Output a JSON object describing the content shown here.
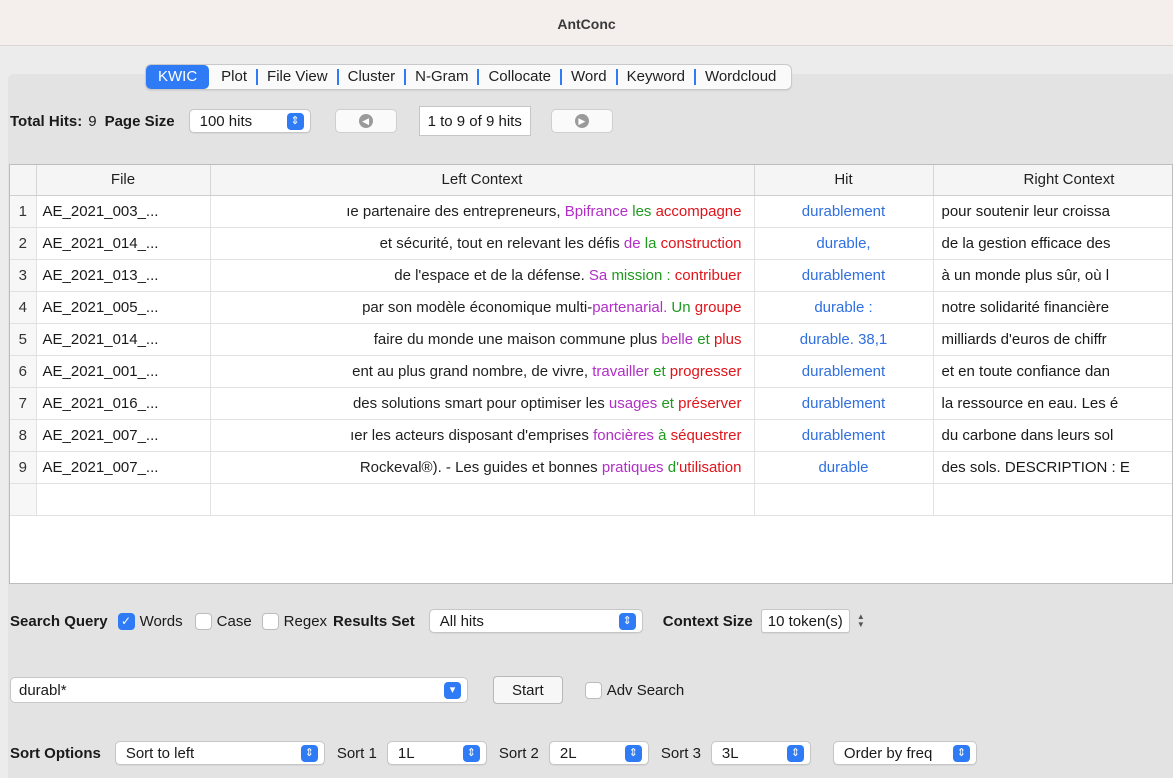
{
  "window": {
    "title": "AntConc"
  },
  "tabs": [
    {
      "label": "KWIC",
      "active": true
    },
    {
      "label": "Plot"
    },
    {
      "label": "File View"
    },
    {
      "label": "Cluster"
    },
    {
      "label": "N-Gram"
    },
    {
      "label": "Collocate"
    },
    {
      "label": "Word"
    },
    {
      "label": "Keyword"
    },
    {
      "label": "Wordcloud"
    }
  ],
  "hits_bar": {
    "total_hits_label": "Total Hits:",
    "total_hits_value": "9",
    "page_size_label": "Page Size",
    "page_size_value": "100 hits",
    "range_text": "1 to 9 of 9 hits",
    "prev_icon": "arrow-left-circle",
    "next_icon": "arrow-right-circle"
  },
  "table": {
    "columns": [
      "File",
      "Left Context",
      "Hit",
      "Right Context"
    ],
    "rows": [
      {
        "num": "1",
        "file": "AE_2021_003_...",
        "left_plain": "ıe partenaire des entrepreneurs, ",
        "l3": "Bpifrance",
        "l2": "les",
        "l1": "accompagne",
        "hit": "durablement",
        "right": "pour soutenir leur croissa"
      },
      {
        "num": "2",
        "file": "AE_2021_014_...",
        "left_plain": "et sécurité, tout en relevant les défis ",
        "l3": "de",
        "l2": "la",
        "l1": "construction",
        "hit": "durable,",
        "right": "de la gestion efficace des"
      },
      {
        "num": "3",
        "file": "AE_2021_013_...",
        "left_plain": "de l'espace et de la défense. ",
        "l3": "Sa",
        "l2": "mission :",
        "l1": "contribuer",
        "hit": "durablement",
        "right": "à un monde plus sûr, où l"
      },
      {
        "num": "4",
        "file": "AE_2021_005_...",
        "left_plain": "par son modèle économique multi-",
        "l3": "partenarial.",
        "l2": "Un",
        "l1": "groupe",
        "hit": "durable :",
        "right": "notre solidarité financière"
      },
      {
        "num": "5",
        "file": "AE_2021_014_...",
        "left_plain": "faire du monde une maison commune plus ",
        "l3": "belle",
        "l2": "et",
        "l1": "plus",
        "hit": "durable. 38,1",
        "right": "milliards d'euros de chiffr"
      },
      {
        "num": "6",
        "file": "AE_2021_001_...",
        "left_plain": "ent au plus grand nombre, de vivre, ",
        "l3": "travailler",
        "l2": "et",
        "l1": "progresser",
        "hit": "durablement",
        "right": "et en toute confiance dan"
      },
      {
        "num": "7",
        "file": "AE_2021_016_...",
        "left_plain": "des solutions smart pour optimiser les ",
        "l3": "usages",
        "l2": "et",
        "l1": "préserver",
        "hit": "durablement",
        "right": "la ressource en eau. Les é"
      },
      {
        "num": "8",
        "file": "AE_2021_007_...",
        "left_plain": "ıer les acteurs disposant d'emprises ",
        "l3": "foncières",
        "l2": "à",
        "l1": "séquestrer",
        "hit": "durablement",
        "right": "du carbone dans leurs sol"
      },
      {
        "num": "9",
        "file": "AE_2021_007_...",
        "left_plain": "Rockeval®). - Les guides et bonnes ",
        "l3": "pratiques",
        "l2": "d'",
        "l1": "utilisation",
        "hit": "durable",
        "right": "des sols. DESCRIPTION : E"
      }
    ]
  },
  "query_options": {
    "search_query_label": "Search Query",
    "words_label": "Words",
    "words_checked": true,
    "case_label": "Case",
    "regex_label": "Regex",
    "results_set_label": "Results Set",
    "results_set_value": "All hits",
    "context_size_label": "Context Size",
    "context_size_value": "10 token(s)"
  },
  "search": {
    "query_value": "durabl*",
    "start_label": "Start",
    "adv_search_label": "Adv Search"
  },
  "sort": {
    "sort_options_label": "Sort Options",
    "sort_mode": "Sort to left",
    "sort1_label": "Sort 1",
    "sort1_value": "1L",
    "sort2_label": "Sort 2",
    "sort2_value": "2L",
    "sort3_label": "Sort 3",
    "sort3_value": "3L",
    "order_value": "Order by freq"
  },
  "colors": {
    "accent": "#2f7bf5",
    "hit_blue": "#2f6fe0",
    "left3_purple": "#b12fc6",
    "left2_green": "#1e9a1e",
    "left1_red": "#e0141a"
  }
}
